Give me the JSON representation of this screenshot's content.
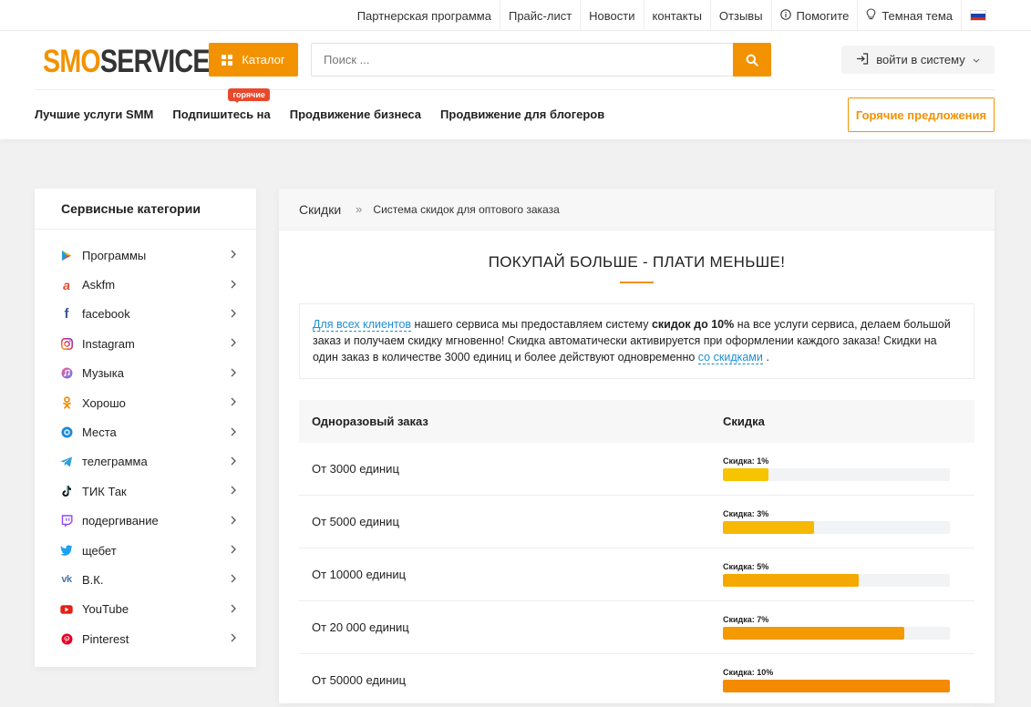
{
  "topnav": {
    "items": [
      "Партнерская программа",
      "Прайс-лист",
      "Новости",
      "контакты",
      "Отзывы"
    ],
    "help": "Помогите",
    "theme": "Темная тема"
  },
  "header": {
    "logo_part1": "SMO",
    "logo_part2": "SERVICE",
    "catalog": "Каталог",
    "search_placeholder": "Поиск ...",
    "login": "войти в систему",
    "nav": [
      "Лучшие услуги SMM",
      "Подпишитесь на",
      "Продвижение бизнеса",
      "Продвижение для блогеров"
    ],
    "hot_badge": "горячие",
    "hot_offers": "Горячие предложения"
  },
  "sidebar": {
    "title": "Сервисные категории",
    "items": [
      {
        "label": "Программы",
        "icon": "play-store-icon"
      },
      {
        "label": "Askfm",
        "icon": "askfm-icon"
      },
      {
        "label": "facebook",
        "icon": "facebook-icon"
      },
      {
        "label": "Instagram",
        "icon": "instagram-icon"
      },
      {
        "label": "Музыка",
        "icon": "music-icon"
      },
      {
        "label": "Хорошо",
        "icon": "odnoklassniki-icon"
      },
      {
        "label": "Места",
        "icon": "places-icon"
      },
      {
        "label": "телеграмма",
        "icon": "telegram-icon"
      },
      {
        "label": "ТИК Так",
        "icon": "tiktok-icon"
      },
      {
        "label": "подергивание",
        "icon": "twitch-icon"
      },
      {
        "label": "щебет",
        "icon": "twitter-icon"
      },
      {
        "label": "В.К.",
        "icon": "vk-icon"
      },
      {
        "label": "YouTube",
        "icon": "youtube-icon"
      },
      {
        "label": "Pinterest",
        "icon": "pinterest-icon"
      }
    ]
  },
  "main": {
    "breadcrumb": [
      "Скидки",
      "»",
      "Система скидок для оптового заказа"
    ],
    "heading": "ПОКУПАЙ БОЛЬШЕ - ПЛАТИ МЕНЬШЕ!",
    "intro": {
      "link1": "Для всех клиентов",
      "t1": " нашего сервиса мы предоставляем систему ",
      "bold": "скидок до 10%",
      "t2": " на все услуги сервиса, делаем большой заказ и получаем скидку мгновенно! Скидка автоматически активируется при оформлении каждого заказа! Скидки на один заказ в количестве 3000 единиц и более действуют одновременно ",
      "link2": "со скидками",
      "t3": " ."
    },
    "table": {
      "headers": [
        "Одноразовый заказ",
        "Скидка"
      ],
      "rows": [
        {
          "order": "От 3000 единиц",
          "label": "Скидка: 1%",
          "fill": 0.2,
          "color": "#f7c400"
        },
        {
          "order": "От 5000 единиц",
          "label": "Скидка: 3%",
          "fill": 0.4,
          "color": "#f6b800"
        },
        {
          "order": "От 10000 единиц",
          "label": "Скидка: 5%",
          "fill": 0.6,
          "color": "#f4a800"
        },
        {
          "order": "От 20 000 единиц",
          "label": "Скидка: 7%",
          "fill": 0.8,
          "color": "#f39a00"
        },
        {
          "order": "От 50000 единиц",
          "label": "Скидка: 10%",
          "fill": 1.0,
          "color": "#f38a00"
        }
      ]
    }
  },
  "colors": {
    "accent": "#f39200",
    "link": "#1d8ed4",
    "badge": "#e8482c"
  }
}
